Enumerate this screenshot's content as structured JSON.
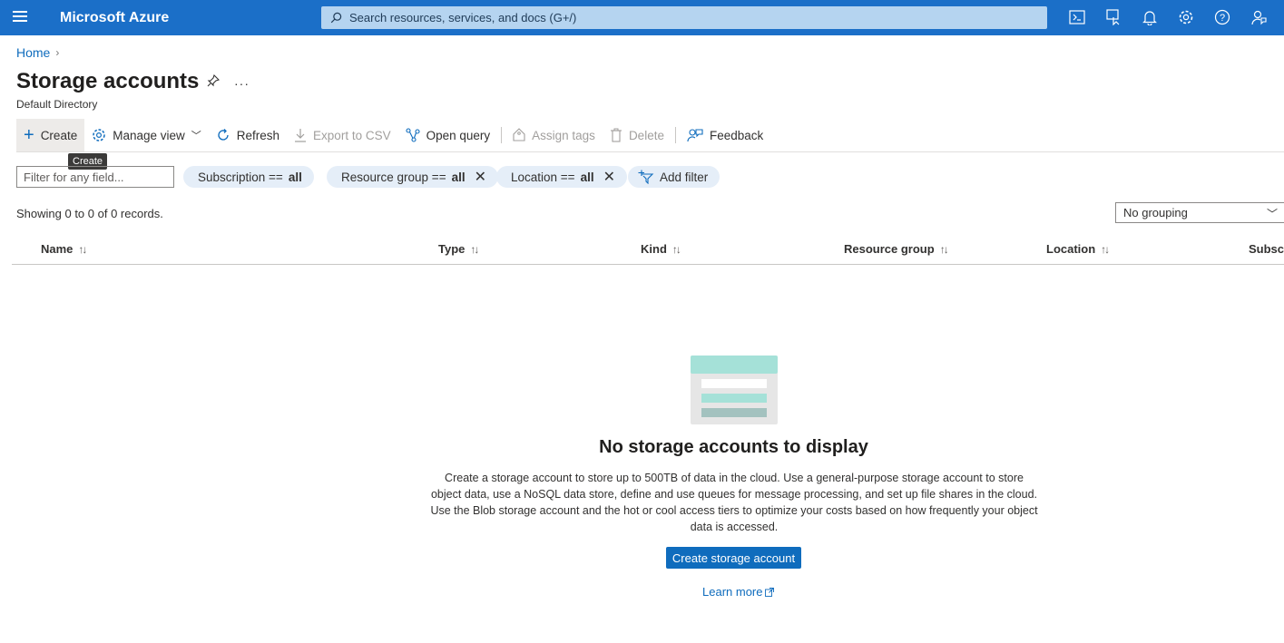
{
  "topbar": {
    "brand": "Microsoft Azure",
    "search_placeholder": "Search resources, services, and docs (G+/)",
    "bg_color": "#1b6fc8",
    "icons": [
      "cloud-shell-icon",
      "directory-filter-icon",
      "notifications-icon",
      "settings-icon",
      "help-icon",
      "feedback-icon"
    ]
  },
  "breadcrumb": {
    "home": "Home"
  },
  "page": {
    "title": "Storage accounts",
    "subtitle": "Default Directory"
  },
  "commands": {
    "create": "Create",
    "manage_view": "Manage view",
    "refresh": "Refresh",
    "export_csv": "Export to CSV",
    "open_query": "Open query",
    "assign_tags": "Assign tags",
    "delete": "Delete",
    "feedback": "Feedback"
  },
  "tooltip": "Create",
  "filters": {
    "placeholder": "Filter for any field...",
    "subscription_label": "Subscription ==",
    "subscription_value": "all",
    "resource_group_label": "Resource group ==",
    "resource_group_value": "all",
    "location_label": "Location ==",
    "location_value": "all",
    "add_filter": "Add filter"
  },
  "records": "Showing 0 to 0 of 0 records.",
  "grouping": "No grouping",
  "columns": [
    "Name",
    "Type",
    "Kind",
    "Resource group",
    "Location",
    "Subscription"
  ],
  "empty": {
    "title": "No storage accounts to display",
    "description": "Create a storage account to store up to 500TB of data in the cloud. Use a general-purpose storage account to store object data, use a NoSQL data store, define and use queues for message processing, and set up file shares in the cloud. Use the Blob storage account and the hot or cool access tiers to optimize your costs based on how frequently your object data is accessed.",
    "button": "Create storage account",
    "learn_more": "Learn more"
  }
}
